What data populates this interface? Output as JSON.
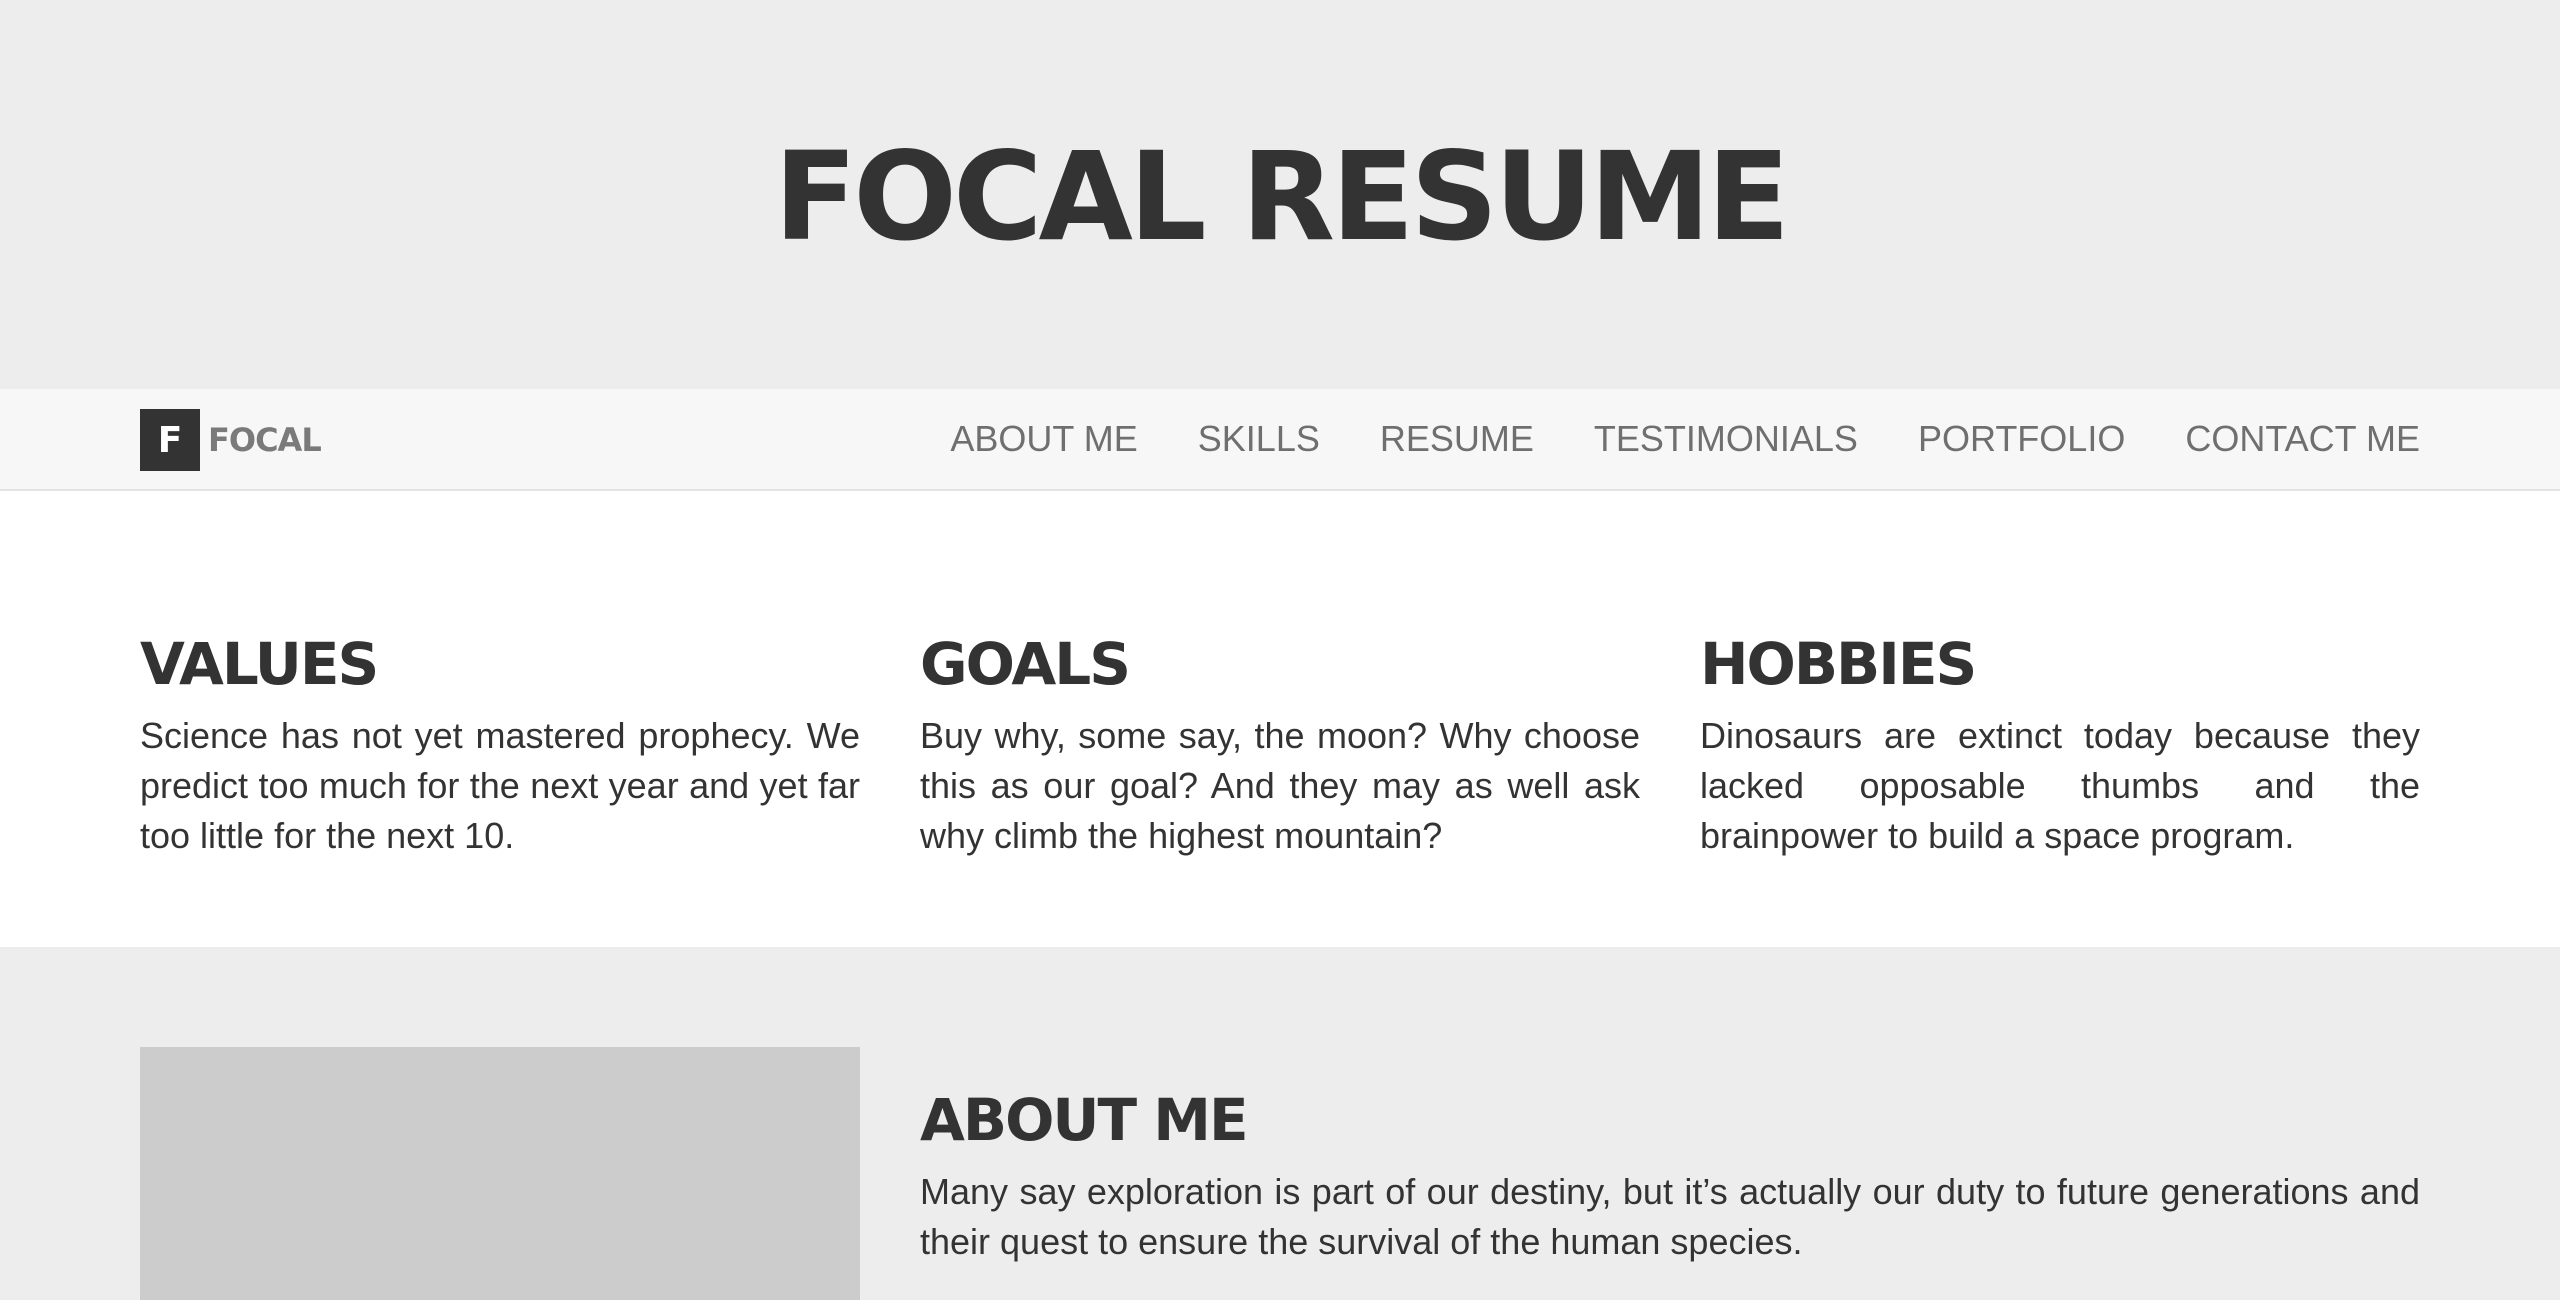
{
  "hero": {
    "title": "FOCAL RESUME"
  },
  "nav": {
    "brand_mark": "F",
    "brand_text": "FOCAL",
    "items": [
      "ABOUT ME",
      "SKILLS",
      "RESUME",
      "TESTIMONIALS",
      "PORTFOLIO",
      "CONTACT ME"
    ]
  },
  "columns": [
    {
      "heading": "VALUES",
      "text": "Science has not yet mastered prophecy. We predict too much for the next year and yet far too little for the next 10."
    },
    {
      "heading": "GOALS",
      "text": "Buy why, some say, the moon? Why choose this as our goal? And they may as well ask why climb the highest mountain?"
    },
    {
      "heading": "HOBBIES",
      "text": "Dinosaurs are extinct today because they lacked opposable thumbs and the brainpower to build a space program."
    }
  ],
  "about": {
    "heading": "ABOUT ME",
    "text": "Many say exploration is part of our destiny, but it’s actually our duty to future generations and their quest to ensure the survival of the human species."
  },
  "colors": {
    "hero_bg": "#ededed",
    "nav_bg": "#f7f7f7",
    "text": "#333333",
    "nav_text": "#6f6f6f",
    "image_placeholder": "#cccccc"
  }
}
